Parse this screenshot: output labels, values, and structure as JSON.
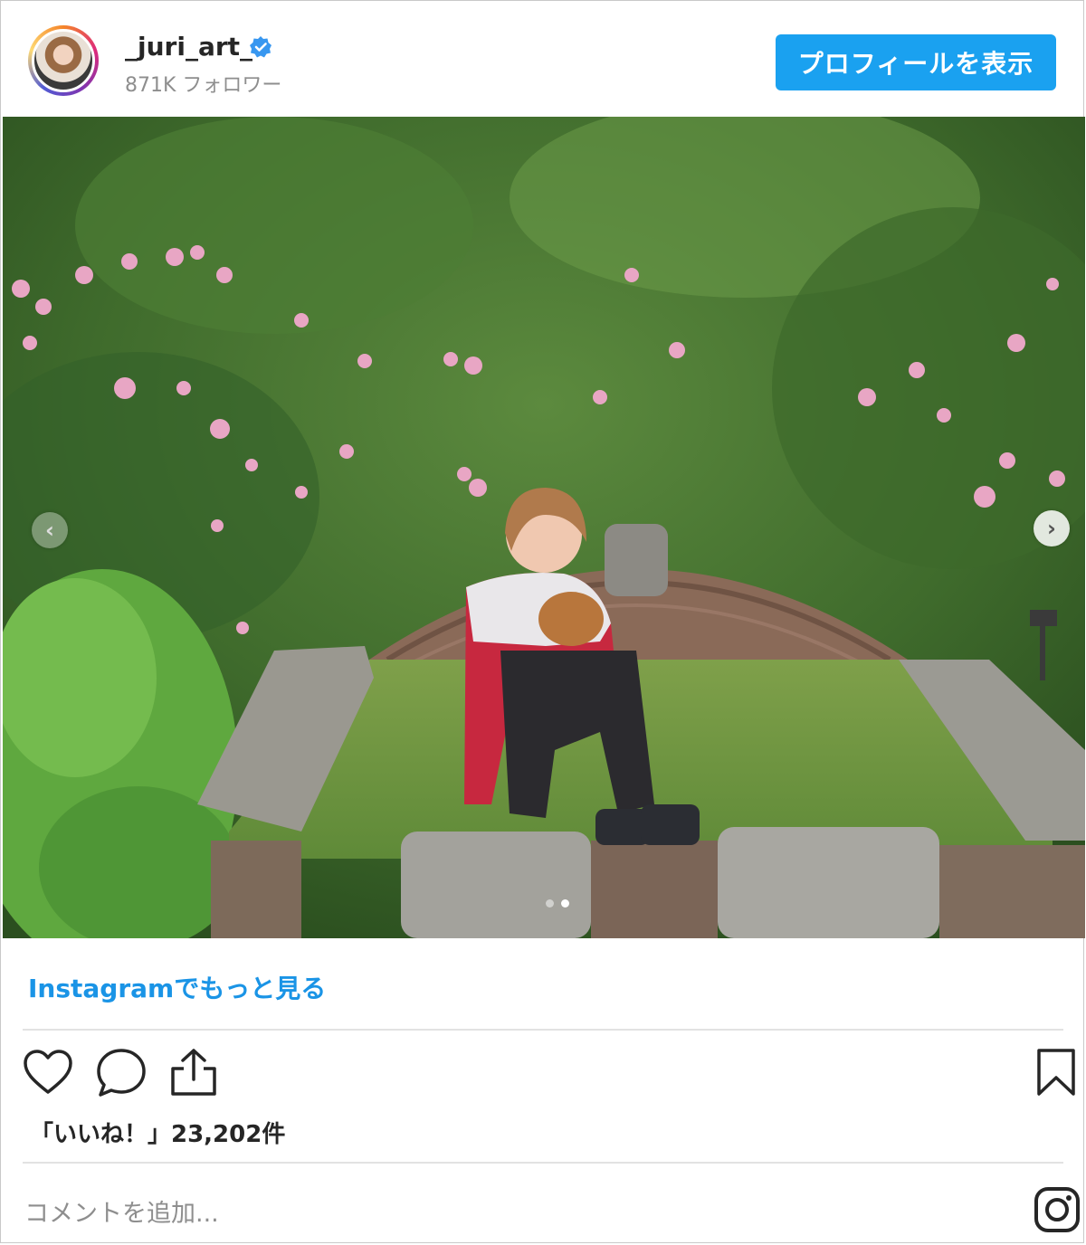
{
  "header": {
    "username": "_juri_art_",
    "followers": "871K フォロワー",
    "profile_button": "プロフィールを表示",
    "verified_icon": "verified-badge-icon",
    "verified_color": "#3897f0"
  },
  "post": {
    "carousel": {
      "slide_count": 2,
      "current_slide": 2
    },
    "more_link": "Instagramでもっと見る",
    "likes_text": "「いいね！」23,202件",
    "comment_placeholder": "コメントを追加..."
  },
  "actions": {
    "like_icon": "heart-icon",
    "comment_icon": "comment-bubble-icon",
    "share_icon": "share-upload-icon",
    "save_icon": "bookmark-icon",
    "brand_icon": "instagram-logo-icon"
  },
  "colors": {
    "accent": "#1aa1f0",
    "link": "#1a94e6",
    "muted": "#8e8e8e"
  }
}
